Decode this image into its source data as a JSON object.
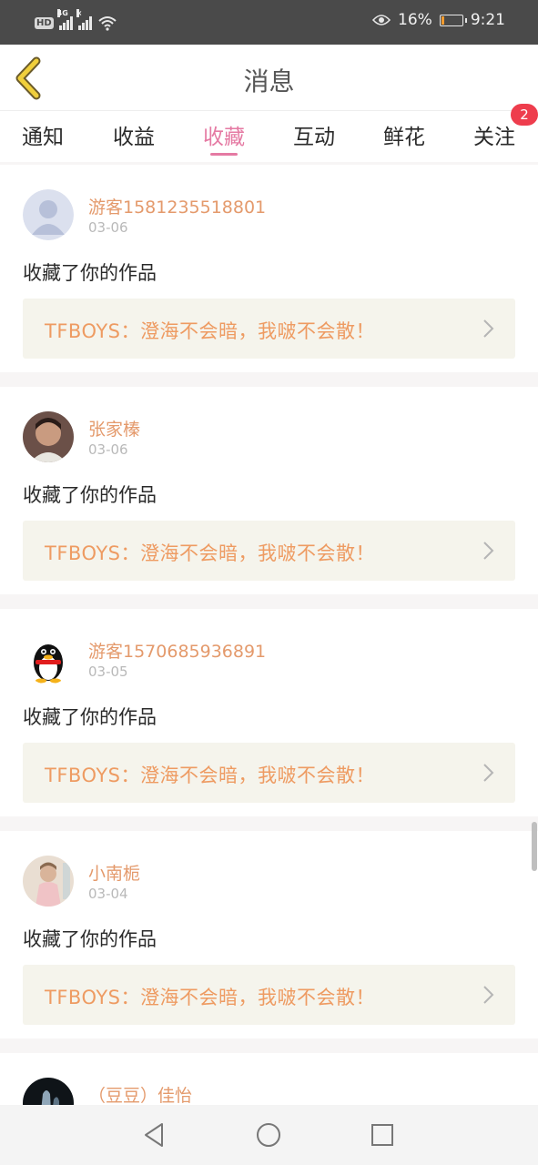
{
  "status_bar": {
    "left": {
      "hd": "HD",
      "network": "4G",
      "no_service_mark": "×"
    },
    "battery_percent": "16%",
    "battery_level": 0.16,
    "time": "9:21",
    "icons": [
      "eye-comfort-icon",
      "battery-icon",
      "wifi-icon",
      "signal-icon"
    ]
  },
  "header": {
    "title": "消息",
    "back_icon": "chevron-left-icon"
  },
  "tabs": [
    {
      "label": "通知",
      "active": false
    },
    {
      "label": "收益",
      "active": false
    },
    {
      "label": "收藏",
      "active": true
    },
    {
      "label": "互动",
      "active": false
    },
    {
      "label": "鲜花",
      "active": false
    },
    {
      "label": "关注",
      "active": false,
      "badge": "2"
    }
  ],
  "colors": {
    "accent_pink": "#e57aa3",
    "name_orange": "#e49a6c",
    "link_orange": "#ee9b62",
    "link_bg": "#f5f4ec",
    "badge_red": "#ee3d4d"
  },
  "messages": [
    {
      "user": "游客1581235518801",
      "date": "03-06",
      "action": "收藏了你的作品",
      "work": "TFBOYS：澄海不会暗，我啵不会散！",
      "avatar": "default-avatar"
    },
    {
      "user": "张家榛",
      "date": "03-06",
      "action": "收藏了你的作品",
      "work": "TFBOYS：澄海不会暗，我啵不会散！",
      "avatar": "photo-avatar"
    },
    {
      "user": "游客1570685936891",
      "date": "03-05",
      "action": "收藏了你的作品",
      "work": "TFBOYS：澄海不会暗，我啵不会散！",
      "avatar": "qq-penguin-avatar"
    },
    {
      "user": "小南栀",
      "date": "03-04",
      "action": "收藏了你的作品",
      "work": "TFBOYS：澄海不会暗，我啵不会散！",
      "avatar": "photo-avatar"
    },
    {
      "user": "（豆豆）佳怡",
      "avatar": "photo-avatar"
    }
  ],
  "nav_bar": {
    "buttons": [
      "back-triangle-icon",
      "home-circle-icon",
      "recents-square-icon"
    ]
  }
}
